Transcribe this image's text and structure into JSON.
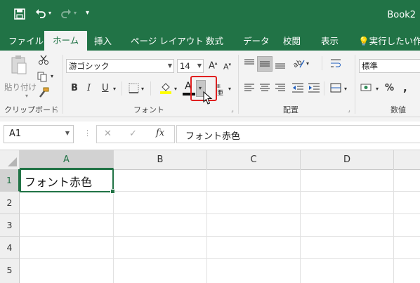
{
  "titlebar": {
    "save_icon": "save-icon",
    "undo_icon": "undo-icon",
    "redo_icon": "redo-icon",
    "customize_icon": "customize-qat-icon",
    "doc_title": "Book2"
  },
  "tabs": [
    {
      "label": "ファイル"
    },
    {
      "label": "ホーム"
    },
    {
      "label": "挿入"
    },
    {
      "label": "ページ レイアウト"
    },
    {
      "label": "数式"
    },
    {
      "label": "データ"
    },
    {
      "label": "校閲"
    },
    {
      "label": "表示"
    },
    {
      "label": "実行したい作業"
    }
  ],
  "ribbon": {
    "clipboard": {
      "paste_label": "貼り付け",
      "group_label": "クリップボード"
    },
    "font": {
      "font_name": "游ゴシック",
      "font_size": "14",
      "bold": "B",
      "italic": "I",
      "underline": "U",
      "font_color_glyph": "A",
      "grow_glyph": "A",
      "shrink_glyph": "A",
      "group_label": "フォント"
    },
    "alignment": {
      "group_label": "配置"
    },
    "number": {
      "format": "標準",
      "percent": "%",
      "comma": ",",
      "group_label": "数値"
    },
    "highlight_color": "#e02020"
  },
  "formula_bar": {
    "name_box": "A1",
    "cancel": "✕",
    "enter": "✓",
    "fx": "fx",
    "content": "フォント赤色"
  },
  "grid": {
    "columns": [
      "A",
      "B",
      "C",
      "D"
    ],
    "rows": [
      "1",
      "2",
      "3",
      "4",
      "5"
    ],
    "cell_A1": "フォント赤色"
  },
  "colors": {
    "excel_green": "#217346",
    "selection": "#217346"
  }
}
